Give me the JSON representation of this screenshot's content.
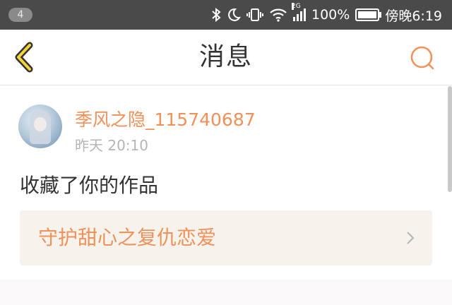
{
  "status_bar": {
    "notification_count": "4",
    "battery_percent": "100%",
    "time": "傍晚6:19",
    "network_type": "2G"
  },
  "header": {
    "title": "消息",
    "accent_color": "#f0915a"
  },
  "message": {
    "username": "季风之隐_115740687",
    "timestamp": "昨天 20:10",
    "action_text": "收藏了你的作品",
    "work_title": "守护甜心之复仇恋爱"
  }
}
